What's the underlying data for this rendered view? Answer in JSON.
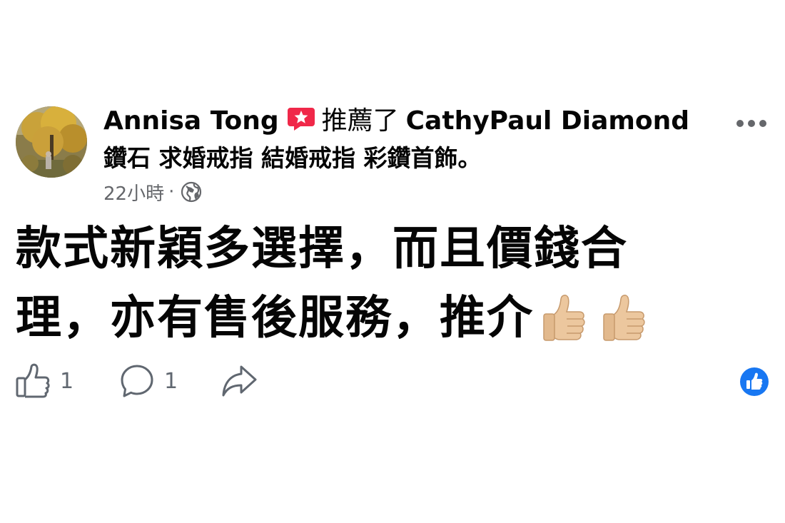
{
  "post": {
    "author": "Annisa Tong",
    "recommend_verb": "推薦了",
    "page_name": "CathyPaul Diamond",
    "page_tagline": "鑽石 求婚戒指 結婚戒指 彩鑽首飾。",
    "time": "22小時",
    "dot": "·",
    "body_line1": "款式新穎多選擇，而且價錢合",
    "body_line2": "理，亦有售後服務，推介",
    "icons": {
      "recommend": "recommend-star-icon",
      "audience": "globe-icon",
      "more": "more-options-icon",
      "emoji": "thumbs-up-emoji",
      "like": "like-icon",
      "comment": "comment-icon",
      "share": "share-icon",
      "reaction": "like-reaction-icon"
    },
    "colors": {
      "recommend_badge": "#f02849",
      "facebook_blue": "#1877f2",
      "secondary_text": "#65676b"
    }
  },
  "actions": {
    "like_count": "1",
    "comment_count": "1"
  }
}
